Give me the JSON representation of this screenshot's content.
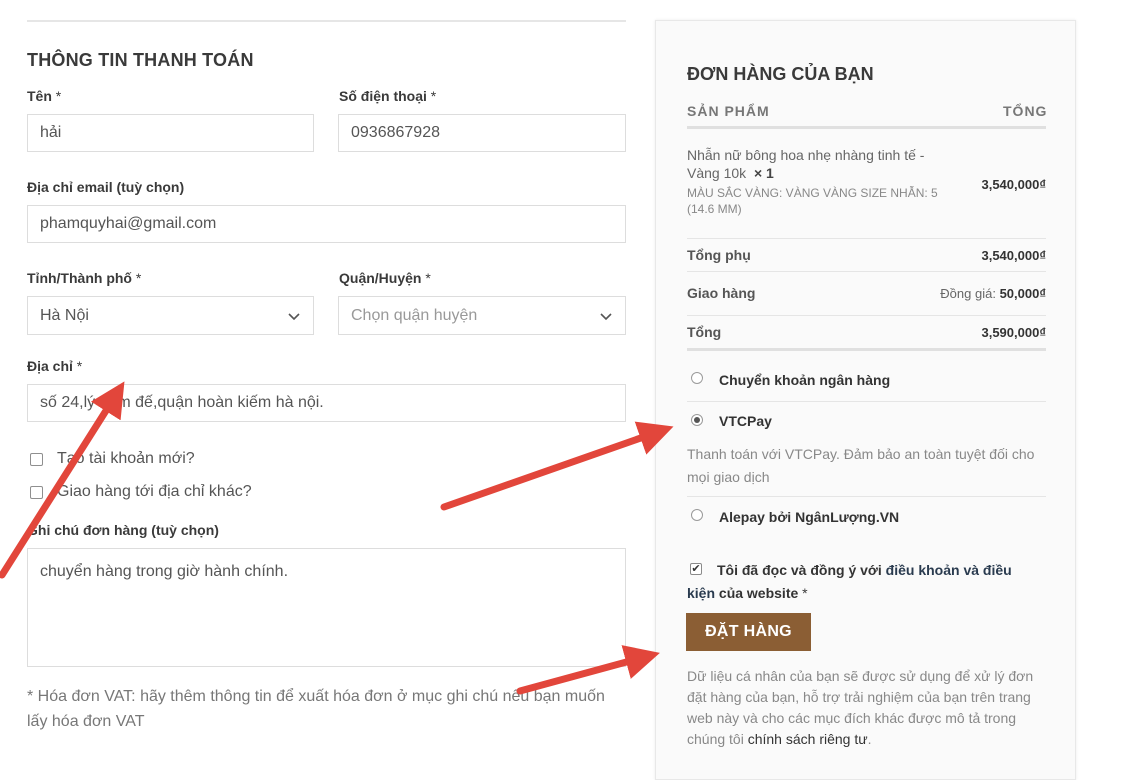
{
  "billing": {
    "title": "THÔNG TIN THANH TOÁN",
    "first_name_label": "Tên",
    "first_name_value": "hải",
    "phone_label": "Số điện thoại",
    "phone_value": "0936867928",
    "email_label": "Địa chỉ email (tuỳ chọn)",
    "email_value": "phamquyhai@gmail.com",
    "province_label": "Tỉnh/Thành phố",
    "province_value": "Hà Nội",
    "district_label": "Quận/Huyện",
    "district_placeholder": "Chọn quận huyện",
    "address_label": "Địa chỉ",
    "address_value": "số 24,lý nam đế,quận hoàn kiếm hà nội.",
    "required_mark": "*",
    "create_account_label": "Tạo tài khoản mới?",
    "ship_different_label": "Giao hàng tới địa chỉ khác?",
    "notes_label": "Ghi chú đơn hàng (tuỳ chọn)",
    "notes_value": "chuyển hàng trong giờ hành chính.",
    "vat_note": "* Hóa đơn VAT: hãy thêm thông tin để xuất hóa đơn ở mục ghi chú nếu bạn muốn lấy hóa đơn VAT"
  },
  "order": {
    "title": "ĐƠN HÀNG CỦA BẠN",
    "col_product": "SẢN PHẨM",
    "col_total": "TỔNG",
    "product_name": "Nhẫn nữ bông hoa nhẹ nhàng tinh tế - Vàng 10k",
    "product_qty": "× 1",
    "product_meta": "MÀU SẮC VÀNG:  VÀNG VÀNG  SIZE NHẪN: 5 (14.6 MM)",
    "product_price": "3,540,000₫",
    "subtotal_label": "Tổng phụ",
    "subtotal_value": "3,540,000₫",
    "shipping_label": "Giao hàng",
    "shipping_note": "Đồng giá:",
    "shipping_value": "50,000₫",
    "total_label": "Tổng",
    "total_value": "3,590,000₫"
  },
  "payment": {
    "methods": [
      {
        "label": "Chuyển khoản ngân hàng",
        "selected": false
      },
      {
        "label": "VTCPay",
        "selected": true
      },
      {
        "label": "Alepay bởi NgânLượng.VN",
        "selected": false
      }
    ],
    "vtcpay_desc": "Thanh toán với VTCPay. Đảm bảo an toàn tuyệt đối cho mọi giao dịch"
  },
  "terms": {
    "checked_glyph": "✔",
    "text_before": "Tôi đã đọc và đồng ý với ",
    "link_text": "điều khoản và điều kiện",
    "text_after": " của website",
    "required_mark": "*"
  },
  "place_order_label": "ĐẶT HÀNG",
  "privacy": {
    "text": "Dữ liệu cá nhân của bạn sẽ được sử dụng để xử lý đơn đặt hàng của bạn, hỗ trợ trải nghiệm của bạn trên trang web này và cho các mục đích khác được mô tả trong chúng tôi ",
    "link_text": "chính sách riêng tư",
    "end": "."
  },
  "colors": {
    "order_button_bg": "#8b5e34",
    "annotation_arrow": "#e2463b"
  },
  "icons": {
    "select_chevron": "chevron-down-icon",
    "annotation": "red-arrow-icon"
  }
}
